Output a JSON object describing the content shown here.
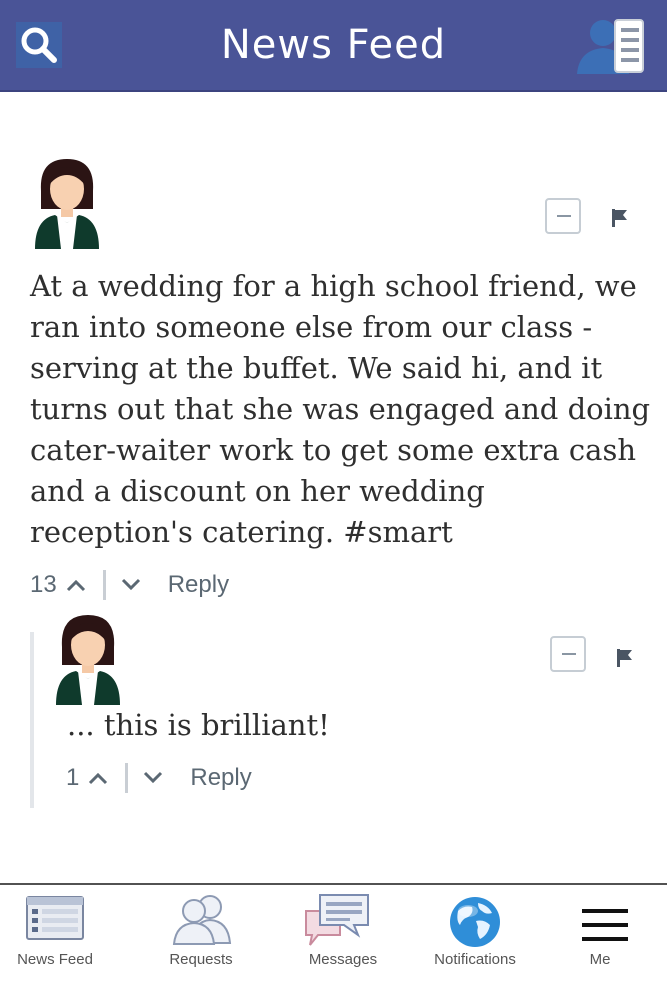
{
  "header": {
    "title": "News Feed"
  },
  "post": {
    "text": "At a wedding for a high school friend, we ran into someone else from our class - serving at the buffet. We said hi, and it turns out that she was engaged and doing cater-waiter work to get some extra cash and a discount on her wedding reception's catering. #smart",
    "votes": "13",
    "reply_label": "Reply"
  },
  "reply": {
    "text": "... this is brilliant!",
    "votes": "1",
    "reply_label": "Reply"
  },
  "bottom_nav": {
    "items": [
      {
        "label": "News Feed",
        "icon": "news-feed-icon"
      },
      {
        "label": "Requests",
        "icon": "requests-icon"
      },
      {
        "label": "Messages",
        "icon": "messages-icon"
      },
      {
        "label": "Notifications",
        "icon": "globe-icon"
      },
      {
        "label": "Me",
        "icon": "menu-icon"
      }
    ]
  },
  "colors": {
    "header_bg": "#4a5497",
    "text": "#2f2f2f",
    "meta": "#5b6873"
  }
}
